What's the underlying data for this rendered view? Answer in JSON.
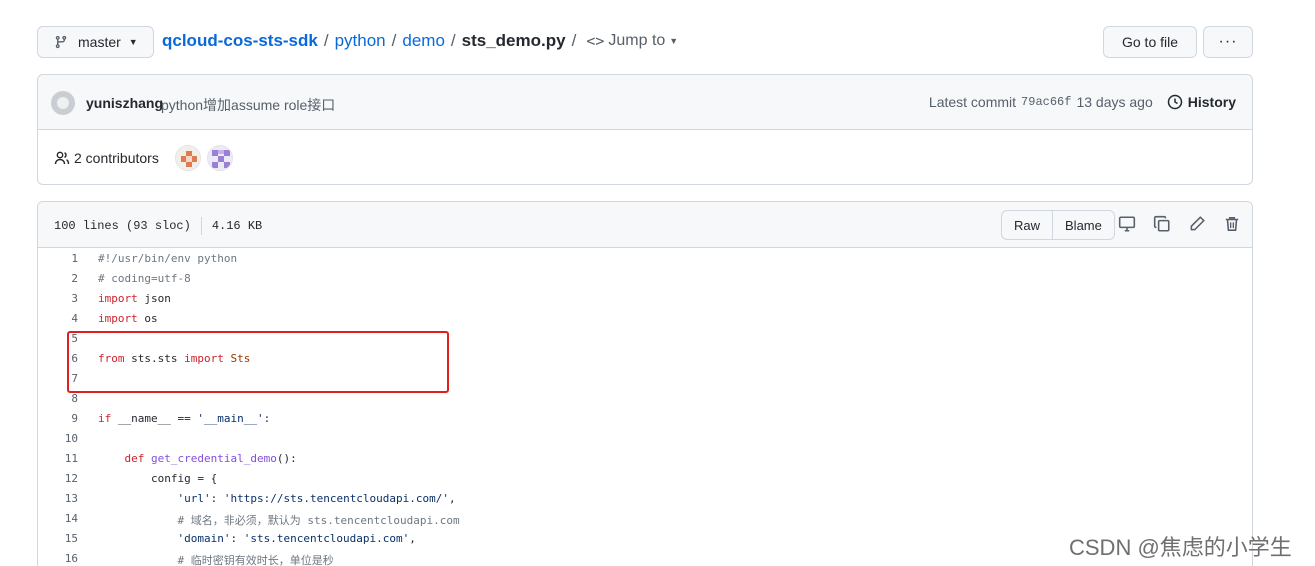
{
  "topbar": {
    "branch": "master",
    "repo": "qcloud-cos-sts-sdk",
    "path": [
      "python",
      "demo"
    ],
    "file": "sts_demo.py",
    "separator": "/",
    "jump_to": "Jump to",
    "go_to_file": "Go to file",
    "more": "···"
  },
  "commit": {
    "author": "yuniszhang",
    "message": "python增加assume role接口",
    "latest_label": "Latest commit",
    "sha": "79ac66f",
    "age": "13 days ago",
    "history": "History"
  },
  "contributors": {
    "label": "2 contributors"
  },
  "file": {
    "lines_info": "100 lines (93 sloc)",
    "size": "4.16 KB",
    "raw": "Raw",
    "blame": "Blame"
  },
  "icons": [
    "branch-icon",
    "code-icon",
    "clock-icon",
    "people-icon",
    "desktop-icon",
    "copy-icon",
    "pencil-icon",
    "trash-icon"
  ],
  "code_lines": [
    {
      "n": "1",
      "text": "#!/usr/bin/env python"
    },
    {
      "n": "2",
      "text": "# coding=utf-8"
    },
    {
      "n": "3",
      "text": "import json"
    },
    {
      "n": "4",
      "text": "import os"
    },
    {
      "n": "5",
      "text": ""
    },
    {
      "n": "6",
      "text": "from sts.sts import Sts"
    },
    {
      "n": "7",
      "text": ""
    },
    {
      "n": "8",
      "text": ""
    },
    {
      "n": "9",
      "text": "if __name__ == '__main__':"
    },
    {
      "n": "10",
      "text": ""
    },
    {
      "n": "11",
      "text": "    def get_credential_demo():"
    },
    {
      "n": "12",
      "text": "        config = {"
    },
    {
      "n": "13",
      "text": "            'url': 'https://sts.tencentcloudapi.com/',"
    },
    {
      "n": "14",
      "text": "            # 域名，非必须，默认为 sts.tencentcloudapi.com"
    },
    {
      "n": "15",
      "text": "            'domain': 'sts.tencentcloudapi.com',"
    },
    {
      "n": "16",
      "text": "            # 临时密钥有效时长，单位是秒"
    }
  ],
  "watermark": "CSDN @焦虑的小学生",
  "colors": {
    "link": "#0969da",
    "keyword": "#cf222e",
    "highlight": "#e02020"
  }
}
